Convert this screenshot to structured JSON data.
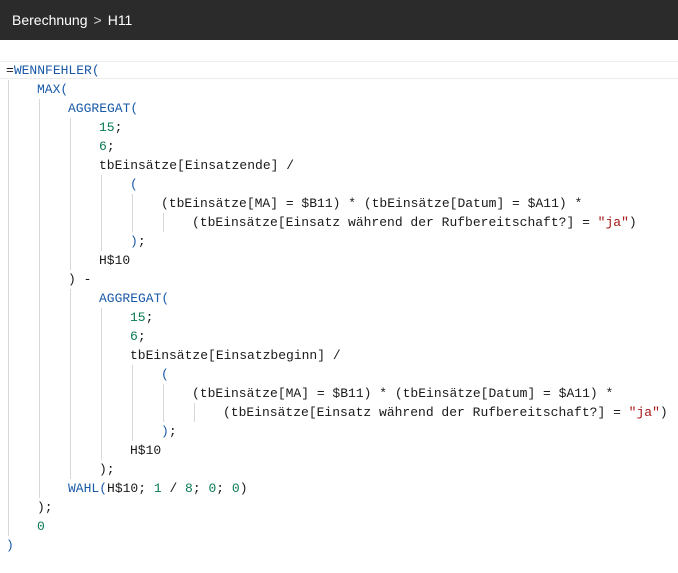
{
  "header": {
    "crumb_parent": "Berechnung",
    "separator": ">",
    "crumb_current": "H11"
  },
  "formula": {
    "lines": [
      {
        "indent": 0,
        "tokens": [
          [
            "op",
            "="
          ],
          [
            "fn",
            "WENNFEHLER("
          ]
        ]
      },
      {
        "indent": 1,
        "tokens": [
          [
            "fn",
            "MAX("
          ]
        ]
      },
      {
        "indent": 2,
        "tokens": [
          [
            "fn",
            "AGGREGAT("
          ]
        ]
      },
      {
        "indent": 3,
        "tokens": [
          [
            "num",
            "15"
          ],
          [
            "op",
            ";"
          ]
        ]
      },
      {
        "indent": 3,
        "tokens": [
          [
            "num",
            "6"
          ],
          [
            "op",
            ";"
          ]
        ]
      },
      {
        "indent": 3,
        "tokens": [
          [
            "op",
            "tbEinsätze[Einsatzende] /"
          ]
        ]
      },
      {
        "indent": 4,
        "tokens": [
          [
            "paren",
            "("
          ]
        ]
      },
      {
        "indent": 5,
        "tokens": [
          [
            "op",
            "(tbEinsätze[MA] = $B11) * (tbEinsätze[Datum] = $A11) *"
          ]
        ]
      },
      {
        "indent": 6,
        "tokens": [
          [
            "op",
            "(tbEinsätze[Einsatz während der Rufbereitschaft?] = "
          ],
          [
            "str",
            "\"ja\""
          ],
          [
            "op",
            ")"
          ]
        ]
      },
      {
        "indent": 4,
        "tokens": [
          [
            "paren",
            ")"
          ],
          [
            "op",
            ";"
          ]
        ]
      },
      {
        "indent": 3,
        "tokens": [
          [
            "op",
            "H$10"
          ]
        ]
      },
      {
        "indent": 2,
        "tokens": [
          [
            "op",
            ") -"
          ]
        ]
      },
      {
        "indent": 3,
        "tokens": [
          [
            "fn",
            "AGGREGAT("
          ]
        ]
      },
      {
        "indent": 4,
        "tokens": [
          [
            "num",
            "15"
          ],
          [
            "op",
            ";"
          ]
        ]
      },
      {
        "indent": 4,
        "tokens": [
          [
            "num",
            "6"
          ],
          [
            "op",
            ";"
          ]
        ]
      },
      {
        "indent": 4,
        "tokens": [
          [
            "op",
            "tbEinsätze[Einsatzbeginn] /"
          ]
        ]
      },
      {
        "indent": 5,
        "tokens": [
          [
            "paren",
            "("
          ]
        ]
      },
      {
        "indent": 6,
        "tokens": [
          [
            "op",
            "(tbEinsätze[MA] = $B11) * (tbEinsätze[Datum] = $A11) *"
          ]
        ]
      },
      {
        "indent": 7,
        "tokens": [
          [
            "op",
            "(tbEinsätze[Einsatz während der Rufbereitschaft?] = "
          ],
          [
            "str",
            "\"ja\""
          ],
          [
            "op",
            ")"
          ]
        ]
      },
      {
        "indent": 5,
        "tokens": [
          [
            "paren",
            ")"
          ],
          [
            "op",
            ";"
          ]
        ]
      },
      {
        "indent": 4,
        "tokens": [
          [
            "op",
            "H$10"
          ]
        ]
      },
      {
        "indent": 3,
        "tokens": [
          [
            "op",
            ");"
          ]
        ]
      },
      {
        "indent": 2,
        "tokens": [
          [
            "fn",
            "WAHL("
          ],
          [
            "op",
            "H$10; "
          ],
          [
            "num",
            "1"
          ],
          [
            "op",
            " / "
          ],
          [
            "num",
            "8"
          ],
          [
            "op",
            "; "
          ],
          [
            "num",
            "0"
          ],
          [
            "op",
            "; "
          ],
          [
            "num",
            "0"
          ],
          [
            "op",
            ")"
          ]
        ]
      },
      {
        "indent": 1,
        "tokens": [
          [
            "op",
            ");"
          ]
        ]
      },
      {
        "indent": 1,
        "tokens": [
          [
            "num",
            "0"
          ]
        ]
      },
      {
        "indent": 0,
        "tokens": [
          [
            "paren",
            ")"
          ]
        ]
      }
    ]
  }
}
